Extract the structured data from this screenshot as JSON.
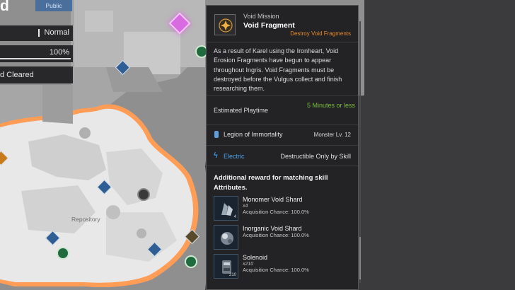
{
  "left_panel": {
    "title_fragment": "d",
    "public_label": "Public",
    "difficulty": "Normal",
    "progress_text": "100%",
    "progress_fraction": 1.0,
    "cleared_text": "d Cleared"
  },
  "map": {
    "repository_label": "Repository",
    "colors": {
      "ground": "#a9a9a9",
      "snow": "#e4e4e4",
      "erosion": "#ff8a3d",
      "background": "#3b3b3d"
    },
    "icons": [
      "void-mission-pin-icon",
      "location-pin-icon",
      "warp-circle-icon"
    ]
  },
  "mission": {
    "type": "Void Mission",
    "name": "Void Fragment",
    "subtitle": "Destroy Void Fragments",
    "description": "As a result of Karel using the Ironheart, Void Erosion Fragments have begun to appear throughout Ingris. Void Fragments must be destroyed before the Vulgus collect and finish researching them.",
    "playtime_label": "Estimated Playtime",
    "playtime_value": "5 Minutes or less",
    "legion": "Legion of Immortality",
    "monster_level": "Monster Lv. 12",
    "attribute": "Electric",
    "attribute_note": "Destructible Only by Skill",
    "reward_title": "Additional reward for matching skill Attributes.",
    "rewards": [
      {
        "name": "Monomer Void Shard",
        "qty": "x4",
        "icon_qty": "4",
        "chance": "Acquisition Chance: 100.0%"
      },
      {
        "name": "Inorganic Void Shard",
        "qty": "",
        "icon_qty": "",
        "chance": "Acquisition Chance: 100.0%"
      },
      {
        "name": "Solenoid",
        "qty": "x210",
        "icon_qty": "210",
        "chance": "Acquisition Chance: 100.0%"
      }
    ],
    "colors": {
      "accent_orange": "#e88a2c",
      "playtime_green": "#7cbd3e",
      "electric_blue": "#4ea3ee"
    }
  }
}
